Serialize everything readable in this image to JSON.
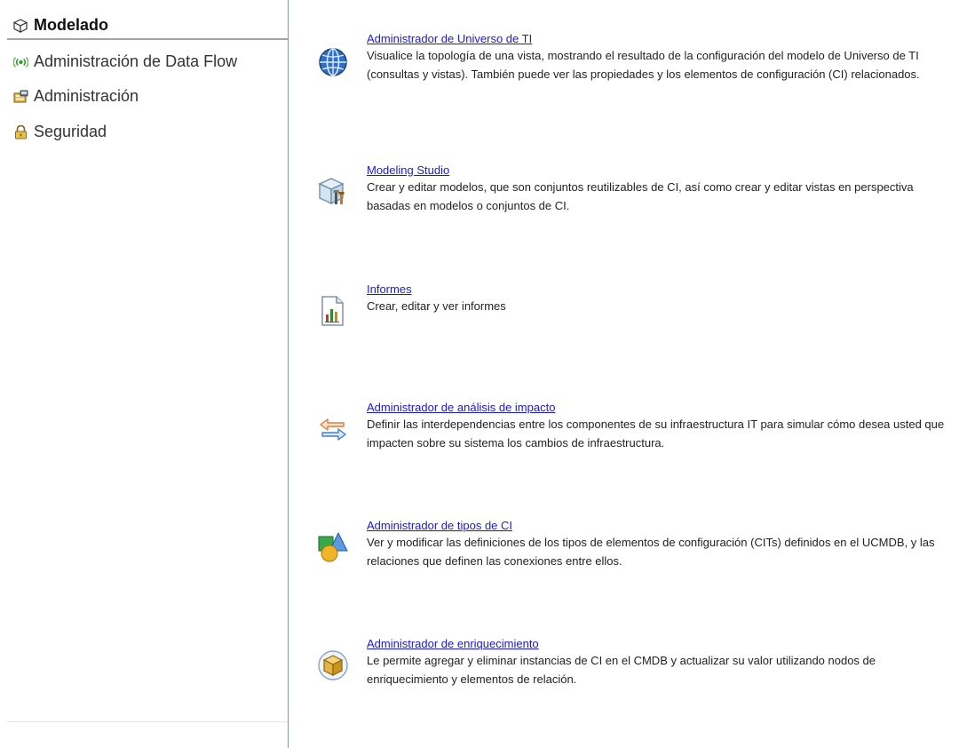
{
  "sidebar": {
    "header": {
      "label": "Modelado",
      "icon": "cube-icon"
    },
    "items": [
      {
        "label": "Administración de Data Flow",
        "icon": "broadcast-icon"
      },
      {
        "label": "Administración",
        "icon": "admin-folder-icon"
      },
      {
        "label": "Seguridad",
        "icon": "lock-icon"
      }
    ]
  },
  "main": {
    "entries": [
      {
        "title": "Administrador de Universo de TI",
        "description": "Visualice la topología de una vista, mostrando el resultado de la configuración del modelo de Universo de TI (consultas y vistas). También puede ver las propiedades y los elementos de configuración (CI) relacionados.",
        "icon": "globe-icon"
      },
      {
        "title": "Modeling Studio",
        "description": "Crear y editar modelos, que son conjuntos reutilizables de CI, así como crear y editar vistas en perspectiva basadas en modelos o conjuntos de CI.",
        "icon": "modeling-cube-tools-icon"
      },
      {
        "title": "Informes",
        "description": "Crear, editar y ver informes",
        "icon": "report-chart-icon"
      },
      {
        "title": "Administrador de análisis de impacto",
        "description": "Definir las interdependencias entre los componentes de su infraestructura IT para simular cómo desea usted que impacten sobre su sistema los cambios de infraestructura.",
        "icon": "swap-arrows-icon"
      },
      {
        "title": "Administrador de tipos de CI",
        "description": "Ver y modificar las definiciones de los tipos de elementos de configuración (CITs) definidos en el UCMDB, y las relaciones que definen las conexiones entre ellos.",
        "icon": "shapes-icon"
      },
      {
        "title": "Administrador de enriquecimiento",
        "description": "Le permite agregar y eliminar instancias de CI en el CMDB y actualizar su valor utilizando nodos de enriquecimiento y elementos de relación.",
        "icon": "enrichment-box-icon"
      }
    ]
  },
  "colors": {
    "link": "#1a1ad0",
    "divider": "#8a9aab",
    "header_underline": "#9fa6ad"
  }
}
